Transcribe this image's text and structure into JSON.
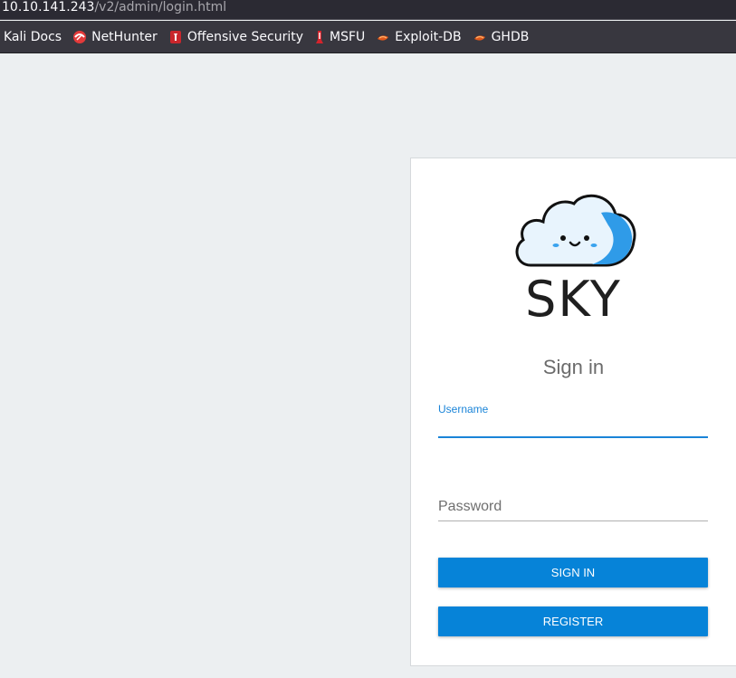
{
  "browser": {
    "url_host": "10.10.141.243",
    "url_path": "/v2/admin/login.html",
    "bookmarks": [
      {
        "label": "Kali Docs",
        "icon": "kali-docs-icon"
      },
      {
        "label": "NetHunter",
        "icon": "nethunter-icon"
      },
      {
        "label": "Offensive Security",
        "icon": "offensive-security-icon"
      },
      {
        "label": "MSFU",
        "icon": "msfu-icon"
      },
      {
        "label": "Exploit-DB",
        "icon": "exploit-db-icon"
      },
      {
        "label": "GHDB",
        "icon": "ghdb-icon"
      }
    ]
  },
  "login": {
    "brand": "SKY",
    "title": "Sign in",
    "username_label": "Username",
    "username_value": "",
    "password_placeholder": "Password",
    "signin_label": "SIGN IN",
    "register_label": "REGISTER"
  },
  "colors": {
    "accent": "#0683d8",
    "page_bg": "#eceff1"
  }
}
